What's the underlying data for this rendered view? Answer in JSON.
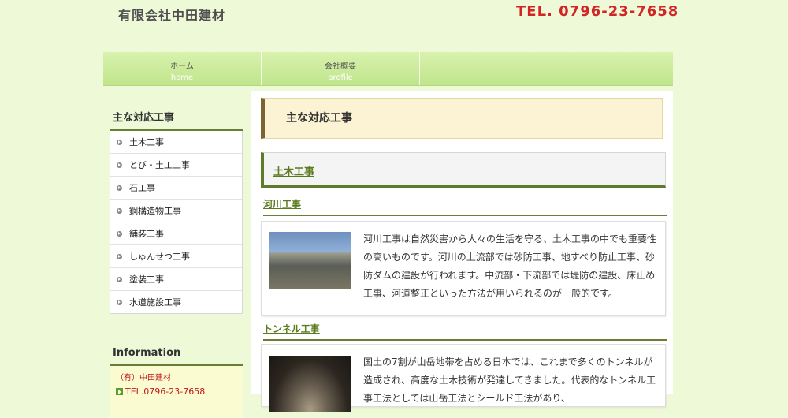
{
  "header": {
    "company_name": "有限会社中田建材",
    "tel": "TEL. 0796-23-7658"
  },
  "nav": [
    {
      "label": "ホーム",
      "sub": "home"
    },
    {
      "label": "会社概要",
      "sub": "profile"
    }
  ],
  "sidebar": {
    "heading": "主な対応工事",
    "items": [
      "土木工事",
      "とび・土工工事",
      "石工事",
      "鋼構造物工事",
      "舗装工事",
      "しゅんせつ工事",
      "塗装工事",
      "水道施設工事"
    ]
  },
  "info": {
    "heading": "Information",
    "company": "（有）中田建材",
    "tel": "TEL.0796-23-7658"
  },
  "main": {
    "page_heading": "主な対応工事",
    "section_heading": "土木工事",
    "river": {
      "heading": "河川工事",
      "text": "河川工事は自然災害から人々の生活を守る、土木工事の中でも重要性の高いものです。河川の上流部では砂防工事、地すべり防止工事、砂防ダムの建設が行われます。中流部・下流部では堤防の建設、床止め工事、河道整正といった方法が用いられるのが一般的です。"
    },
    "tunnel": {
      "heading": "トンネル工事",
      "text": "国土の7割が山岳地帯を占める日本では、これまで多くのトンネルが造成され、高度な土木技術が発達してきました。代表的なトンネル工事工法としては山岳工法とシールド工法があり、"
    }
  },
  "colors": {
    "background": "#eef9d8",
    "tel": "#d22626",
    "accent_green": "#5a7c1e",
    "heading_border": "#6a7d34"
  }
}
